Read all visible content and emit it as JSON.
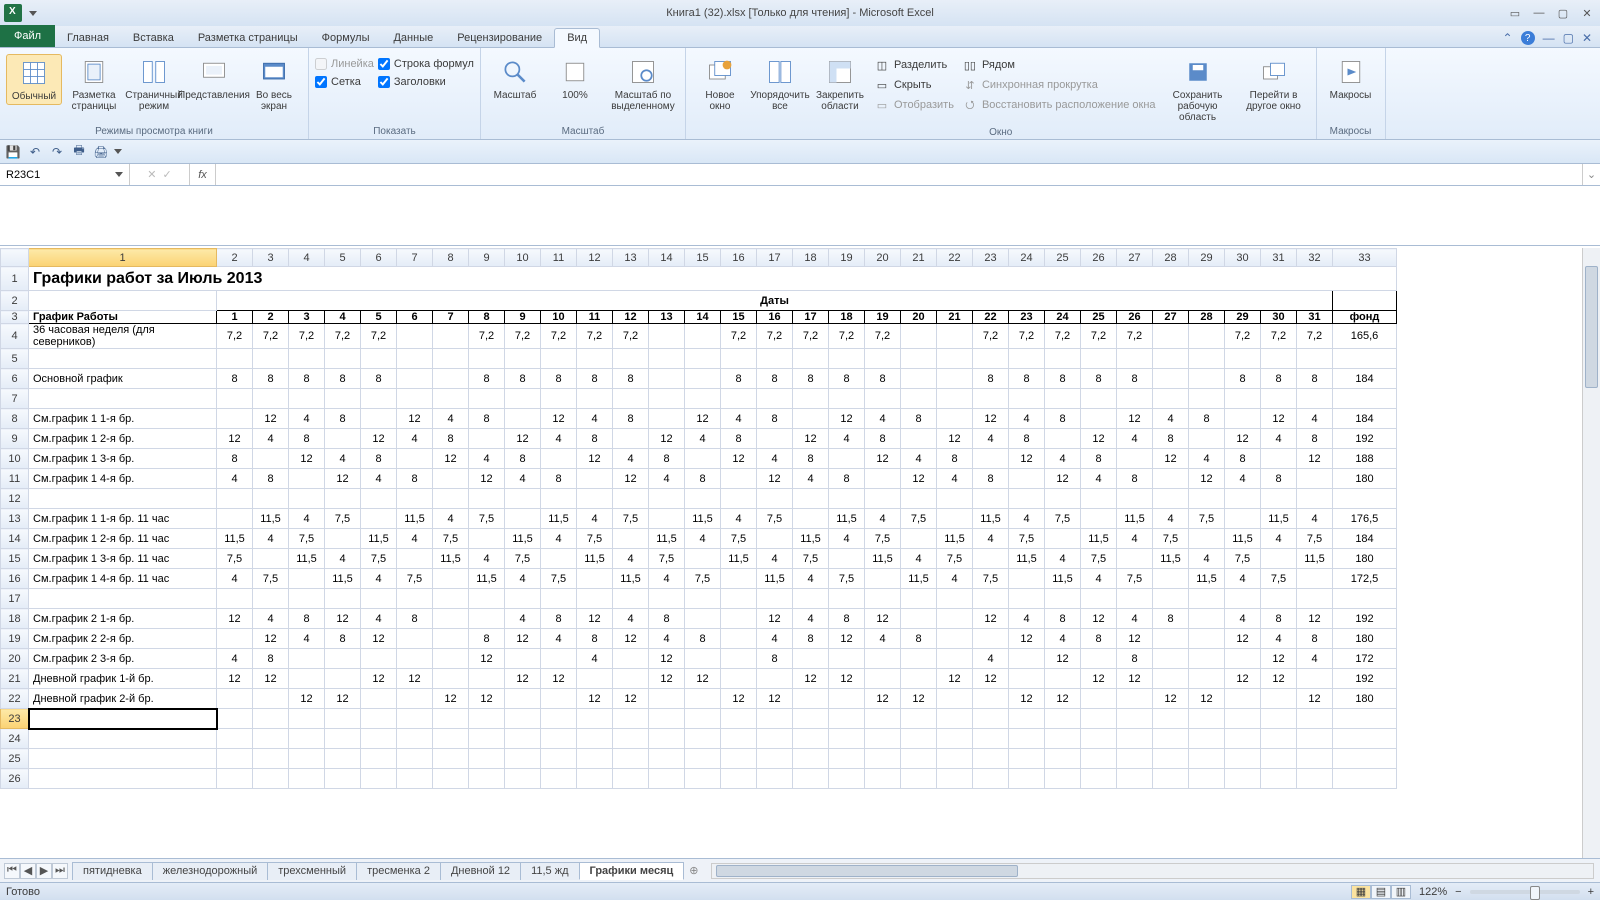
{
  "title": "Книга1 (32).xlsx  [Только для чтения] - Microsoft Excel",
  "ribbon_tabs": {
    "file": "Файл",
    "home": "Главная",
    "insert": "Вставка",
    "layout": "Разметка страницы",
    "formulas": "Формулы",
    "data": "Данные",
    "review": "Рецензирование",
    "view": "Вид"
  },
  "ribbon": {
    "views": {
      "normal": "Обычный",
      "page_layout": "Разметка страницы",
      "page_break": "Страничный режим",
      "custom": "Представления",
      "full": "Во весь экран",
      "group": "Режимы просмотра книги"
    },
    "show": {
      "ruler": "Линейка",
      "formula_bar": "Строка формул",
      "grid": "Сетка",
      "headings": "Заголовки",
      "group": "Показать"
    },
    "zoom": {
      "zoom": "Масштаб",
      "hundred": "100%",
      "selection": "Масштаб по выделенному",
      "group": "Масштаб"
    },
    "window": {
      "new": "Новое окно",
      "arrange": "Упорядочить все",
      "freeze": "Закрепить области",
      "split": "Разделить",
      "hide": "Скрыть",
      "unhide": "Отобразить",
      "side": "Рядом",
      "sync": "Синхронная прокрутка",
      "reset": "Восстановить расположение окна",
      "save_ws": "Сохранить рабочую область",
      "switch": "Перейти в другое окно",
      "group": "Окно"
    },
    "macros": {
      "macros": "Макросы",
      "group": "Макросы"
    }
  },
  "namebox": "R23C1",
  "formula": "",
  "col_headers": [
    "1",
    "2",
    "3",
    "4",
    "5",
    "6",
    "7",
    "8",
    "9",
    "10",
    "11",
    "12",
    "13",
    "14",
    "15",
    "16",
    "17",
    "18",
    "19",
    "20",
    "21",
    "22",
    "23",
    "24",
    "25",
    "26",
    "27",
    "28",
    "29",
    "30",
    "31",
    "32",
    "33"
  ],
  "row_headers": [
    "1",
    "2",
    "3",
    "4",
    "5",
    "6",
    "7",
    "8",
    "9",
    "10",
    "11",
    "12",
    "13",
    "14",
    "15",
    "16",
    "17",
    "18",
    "19",
    "20",
    "21",
    "22",
    "23",
    "24",
    "25",
    "26"
  ],
  "sheet": {
    "title": "Графики работ за Июль 2013",
    "dates_label": "Даты",
    "schedule_label": "График Работы",
    "day_headers": [
      "1",
      "2",
      "3",
      "4",
      "5",
      "6",
      "7",
      "8",
      "9",
      "10",
      "11",
      "12",
      "13",
      "14",
      "15",
      "16",
      "17",
      "18",
      "19",
      "20",
      "21",
      "22",
      "23",
      "24",
      "25",
      "26",
      "27",
      "28",
      "29",
      "30",
      "31"
    ],
    "fund_label": "фонд",
    "rows": [
      {
        "label": "36 часовая неделя (для северников)",
        "vals": [
          "7,2",
          "7,2",
          "7,2",
          "7,2",
          "7,2",
          "",
          "",
          "7,2",
          "7,2",
          "7,2",
          "7,2",
          "7,2",
          "",
          "",
          "7,2",
          "7,2",
          "7,2",
          "7,2",
          "7,2",
          "",
          "",
          "7,2",
          "7,2",
          "7,2",
          "7,2",
          "7,2",
          "",
          "",
          "7,2",
          "7,2",
          "7,2"
        ],
        "fund": "165,6"
      },
      {
        "label": "",
        "vals": [
          "",
          "",
          "",
          "",
          "",
          "",
          "",
          "",
          "",
          "",
          "",
          "",
          "",
          "",
          "",
          "",
          "",
          "",
          "",
          "",
          "",
          "",
          "",
          "",
          "",
          "",
          "",
          "",
          "",
          "",
          ""
        ],
        "fund": ""
      },
      {
        "label": "Основной график",
        "vals": [
          "8",
          "8",
          "8",
          "8",
          "8",
          "",
          "",
          "8",
          "8",
          "8",
          "8",
          "8",
          "",
          "",
          "8",
          "8",
          "8",
          "8",
          "8",
          "",
          "",
          "8",
          "8",
          "8",
          "8",
          "8",
          "",
          "",
          "8",
          "8",
          "8"
        ],
        "fund": "184"
      },
      {
        "label": "",
        "vals": [
          "",
          "",
          "",
          "",
          "",
          "",
          "",
          "",
          "",
          "",
          "",
          "",
          "",
          "",
          "",
          "",
          "",
          "",
          "",
          "",
          "",
          "",
          "",
          "",
          "",
          "",
          "",
          "",
          "",
          "",
          ""
        ],
        "fund": ""
      },
      {
        "label": "См.график 1   1-я бр.",
        "vals": [
          "",
          "12",
          "4",
          "8",
          "",
          "12",
          "4",
          "8",
          "",
          "12",
          "4",
          "8",
          "",
          "12",
          "4",
          "8",
          "",
          "12",
          "4",
          "8",
          "",
          "12",
          "4",
          "8",
          "",
          "12",
          "4",
          "8",
          "",
          "12",
          "4"
        ],
        "fund": "184"
      },
      {
        "label": "См.график 1   2-я бр.",
        "vals": [
          "12",
          "4",
          "8",
          "",
          "12",
          "4",
          "8",
          "",
          "12",
          "4",
          "8",
          "",
          "12",
          "4",
          "8",
          "",
          "12",
          "4",
          "8",
          "",
          "12",
          "4",
          "8",
          "",
          "12",
          "4",
          "8",
          "",
          "12",
          "4",
          "8"
        ],
        "fund": "192"
      },
      {
        "label": "См.график 1   3-я бр.",
        "vals": [
          "8",
          "",
          "12",
          "4",
          "8",
          "",
          "12",
          "4",
          "8",
          "",
          "12",
          "4",
          "8",
          "",
          "12",
          "4",
          "8",
          "",
          "12",
          "4",
          "8",
          "",
          "12",
          "4",
          "8",
          "",
          "12",
          "4",
          "8",
          "",
          "12"
        ],
        "fund": "188"
      },
      {
        "label": "См.график 1   4-я бр.",
        "vals": [
          "4",
          "8",
          "",
          "12",
          "4",
          "8",
          "",
          "12",
          "4",
          "8",
          "",
          "12",
          "4",
          "8",
          "",
          "12",
          "4",
          "8",
          "",
          "12",
          "4",
          "8",
          "",
          "12",
          "4",
          "8",
          "",
          "12",
          "4",
          "8",
          ""
        ],
        "fund": "180"
      },
      {
        "label": "",
        "vals": [
          "",
          "",
          "",
          "",
          "",
          "",
          "",
          "",
          "",
          "",
          "",
          "",
          "",
          "",
          "",
          "",
          "",
          "",
          "",
          "",
          "",
          "",
          "",
          "",
          "",
          "",
          "",
          "",
          "",
          "",
          ""
        ],
        "fund": ""
      },
      {
        "label": "См.график 1   1-я бр. 11 час",
        "vals": [
          "",
          "11,5",
          "4",
          "7,5",
          "",
          "11,5",
          "4",
          "7,5",
          "",
          "11,5",
          "4",
          "7,5",
          "",
          "11,5",
          "4",
          "7,5",
          "",
          "11,5",
          "4",
          "7,5",
          "",
          "11,5",
          "4",
          "7,5",
          "",
          "11,5",
          "4",
          "7,5",
          "",
          "11,5",
          "4"
        ],
        "fund": "176,5"
      },
      {
        "label": "См.график 1   2-я бр. 11 час",
        "vals": [
          "11,5",
          "4",
          "7,5",
          "",
          "11,5",
          "4",
          "7,5",
          "",
          "11,5",
          "4",
          "7,5",
          "",
          "11,5",
          "4",
          "7,5",
          "",
          "11,5",
          "4",
          "7,5",
          "",
          "11,5",
          "4",
          "7,5",
          "",
          "11,5",
          "4",
          "7,5",
          "",
          "11,5",
          "4",
          "7,5"
        ],
        "fund": "184"
      },
      {
        "label": "См.график 1   3-я бр. 11 час",
        "vals": [
          "7,5",
          "",
          "11,5",
          "4",
          "7,5",
          "",
          "11,5",
          "4",
          "7,5",
          "",
          "11,5",
          "4",
          "7,5",
          "",
          "11,5",
          "4",
          "7,5",
          "",
          "11,5",
          "4",
          "7,5",
          "",
          "11,5",
          "4",
          "7,5",
          "",
          "11,5",
          "4",
          "7,5",
          "",
          "11,5"
        ],
        "fund": "180"
      },
      {
        "label": "См.график 1   4-я бр. 11 час",
        "vals": [
          "4",
          "7,5",
          "",
          "11,5",
          "4",
          "7,5",
          "",
          "11,5",
          "4",
          "7,5",
          "",
          "11,5",
          "4",
          "7,5",
          "",
          "11,5",
          "4",
          "7,5",
          "",
          "11,5",
          "4",
          "7,5",
          "",
          "11,5",
          "4",
          "7,5",
          "",
          "11,5",
          "4",
          "7,5",
          ""
        ],
        "fund": "172,5"
      },
      {
        "label": "",
        "vals": [
          "",
          "",
          "",
          "",
          "",
          "",
          "",
          "",
          "",
          "",
          "",
          "",
          "",
          "",
          "",
          "",
          "",
          "",
          "",
          "",
          "",
          "",
          "",
          "",
          "",
          "",
          "",
          "",
          "",
          "",
          ""
        ],
        "fund": ""
      },
      {
        "label": "См.график 2   1-я бр.",
        "vals": [
          "12",
          "4",
          "8",
          "12",
          "4",
          "8",
          "",
          "",
          "4",
          "8",
          "12",
          "4",
          "8",
          "",
          "",
          "12",
          "4",
          "8",
          "12",
          "",
          "",
          "12",
          "4",
          "8",
          "12",
          "4",
          "8",
          "",
          "4",
          "8",
          "12"
        ],
        "fund": "192"
      },
      {
        "label": "См.график 2   2-я бр.",
        "vals": [
          "",
          "12",
          "4",
          "8",
          "12",
          "",
          "",
          "8",
          "12",
          "4",
          "8",
          "12",
          "4",
          "8",
          "",
          "4",
          "8",
          "12",
          "4",
          "8",
          "",
          "",
          "12",
          "4",
          "8",
          "12",
          "",
          "",
          "12",
          "4",
          "8"
        ],
        "fund": "180"
      },
      {
        "label": "См.график 2   3-я бр.",
        "vals": [
          "4",
          "8",
          "",
          "",
          "",
          "",
          "",
          "12",
          "",
          "",
          "4",
          "",
          "12",
          "",
          "",
          "8",
          "",
          "",
          "",
          "",
          "",
          "4",
          "",
          "12",
          "",
          "8",
          "",
          "",
          "",
          "12",
          "4"
        ],
        "fund": "172"
      },
      {
        "label": "Дневной график 1-й бр.",
        "vals": [
          "12",
          "12",
          "",
          "",
          "12",
          "12",
          "",
          "",
          "12",
          "12",
          "",
          "",
          "12",
          "12",
          "",
          "",
          "12",
          "12",
          "",
          "",
          "12",
          "12",
          "",
          "",
          "12",
          "12",
          "",
          "",
          "12",
          "12",
          ""
        ],
        "fund": "192"
      },
      {
        "label": "Дневной график 2-й бр.",
        "vals": [
          "",
          "",
          "12",
          "12",
          "",
          "",
          "12",
          "12",
          "",
          "",
          "12",
          "12",
          "",
          "",
          "12",
          "12",
          "",
          "",
          "12",
          "12",
          "",
          "",
          "12",
          "12",
          "",
          "",
          "12",
          "12",
          "",
          "",
          "12"
        ],
        "fund": "180"
      }
    ]
  },
  "sheet_tabs": [
    "пятидневка",
    "железнодорожный",
    "трехсменный",
    "тресменка 2",
    "Дневной 12",
    "11,5 жд",
    "Графики месяц"
  ],
  "active_tab_index": 6,
  "status": {
    "ready": "Готово",
    "zoom": "122%"
  }
}
